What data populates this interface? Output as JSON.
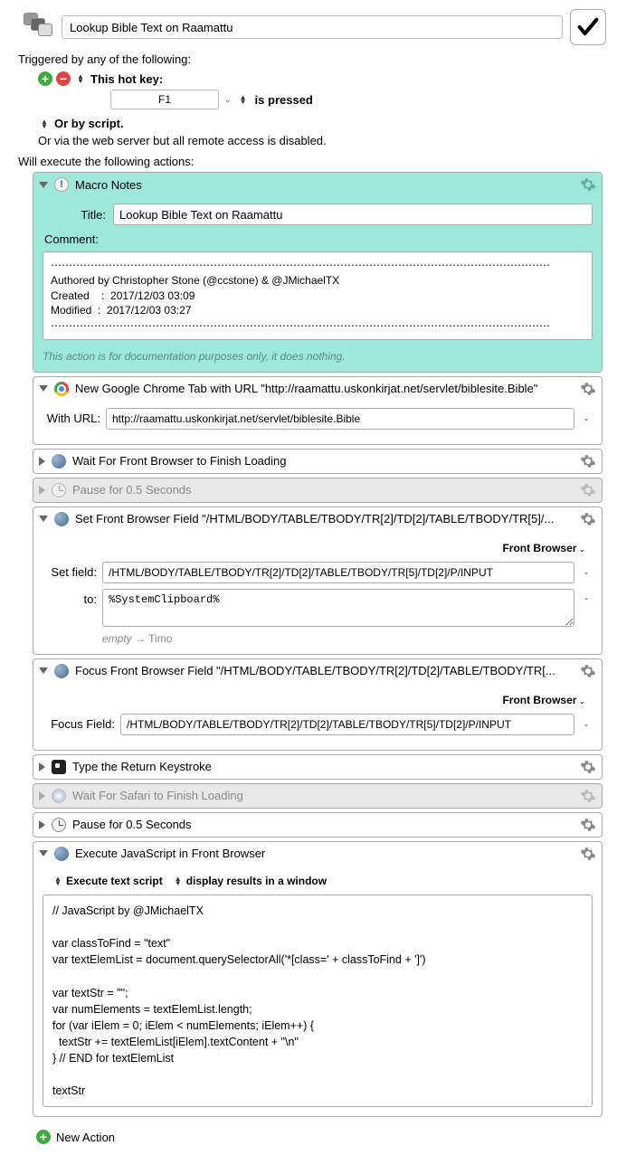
{
  "header": {
    "title": "Lookup Bible Text on Raamattu"
  },
  "triggers": {
    "heading": "Triggered by any of the following:",
    "hotkey_label": "This hot key:",
    "hotkey_value": "F1",
    "pressed_label": "is pressed",
    "script_label": "Or by script.",
    "webserver_text": "Or via the web server but all remote access is disabled."
  },
  "actions_heading": "Will execute the following actions:",
  "macro_notes": {
    "title": "Macro Notes",
    "title_label": "Title:",
    "title_value": "Lookup Bible Text on Raamattu",
    "comment_label": "Comment:",
    "comment_text": "⋯⋯⋯⋯⋯⋯⋯⋯⋯⋯⋯⋯⋯⋯⋯⋯⋯⋯⋯⋯⋯⋯⋯⋯⋯⋯⋯⋯⋯⋯⋯⋯⋯⋯⋯⋯⋯⋯⋯⋯⋯⋯⋯⋯⋯⋯\nAuthored by Christopher Stone (@ccstone) & @JMichaelTX\nCreated    :  2017/12/03 03:09\nModified  :  2017/12/03 03:27\n⋯⋯⋯⋯⋯⋯⋯⋯⋯⋯⋯⋯⋯⋯⋯⋯⋯⋯⋯⋯⋯⋯⋯⋯⋯⋯⋯⋯⋯⋯⋯⋯⋯⋯⋯⋯⋯⋯⋯⋯⋯⋯⋯⋯⋯⋯",
    "footer_note": "This action is for documentation purposes only, it does nothing."
  },
  "chrome_tab": {
    "title": "New Google Chrome Tab with URL \"http://raamattu.uskonkirjat.net/servlet/biblesite.Bible\"",
    "url_label": "With URL:",
    "url_value": "http://raamattu.uskonkirjat.net/servlet/biblesite.Bible"
  },
  "wait_browser": {
    "title": "Wait For Front Browser to Finish Loading"
  },
  "pause1": {
    "title": "Pause for 0.5 Seconds"
  },
  "set_field": {
    "title": "Set Front Browser Field \"/HTML/BODY/TABLE/TBODY/TR[2]/TD[2]/TABLE/TBODY/TR[5]/...",
    "front_browser": "Front Browser",
    "set_label": "Set field:",
    "set_value": "/HTML/BODY/TABLE/TBODY/TR[2]/TD[2]/TABLE/TBODY/TR[5]/TD[2]/P/INPUT",
    "to_label": "to:",
    "to_value": "%SystemClipboard%",
    "empty_label": "empty",
    "empty_arrow": "→",
    "empty_value": "Timo"
  },
  "focus_field": {
    "title": "Focus Front Browser Field \"/HTML/BODY/TABLE/TBODY/TR[2]/TD[2]/TABLE/TBODY/TR[...",
    "front_browser": "Front Browser",
    "focus_label": "Focus Field:",
    "focus_value": "/HTML/BODY/TABLE/TBODY/TR[2]/TD[2]/TABLE/TBODY/TR[5]/TD[2]/P/INPUT"
  },
  "type_return": {
    "title": "Type the Return Keystroke"
  },
  "wait_safari": {
    "title": "Wait For Safari to Finish Loading"
  },
  "pause2": {
    "title": "Pause for 0.5 Seconds"
  },
  "exec_js": {
    "title": "Execute JavaScript in Front Browser",
    "opt1": "Execute text script",
    "opt2": "display results in a window",
    "code": "// JavaScript by @JMichaelTX\n\nvar classToFind = \"text\"\nvar textElemList = document.querySelectorAll('*[class=' + classToFind + ']')\n\nvar textStr = \"\";\nvar numElements = textElemList.length;\nfor (var iElem = 0; iElem < numElements; iElem++) {\n  textStr += textElemList[iElem].textContent + \"\\n\"\n} // END for textElemList\n\ntextStr"
  },
  "new_action_label": "New Action"
}
